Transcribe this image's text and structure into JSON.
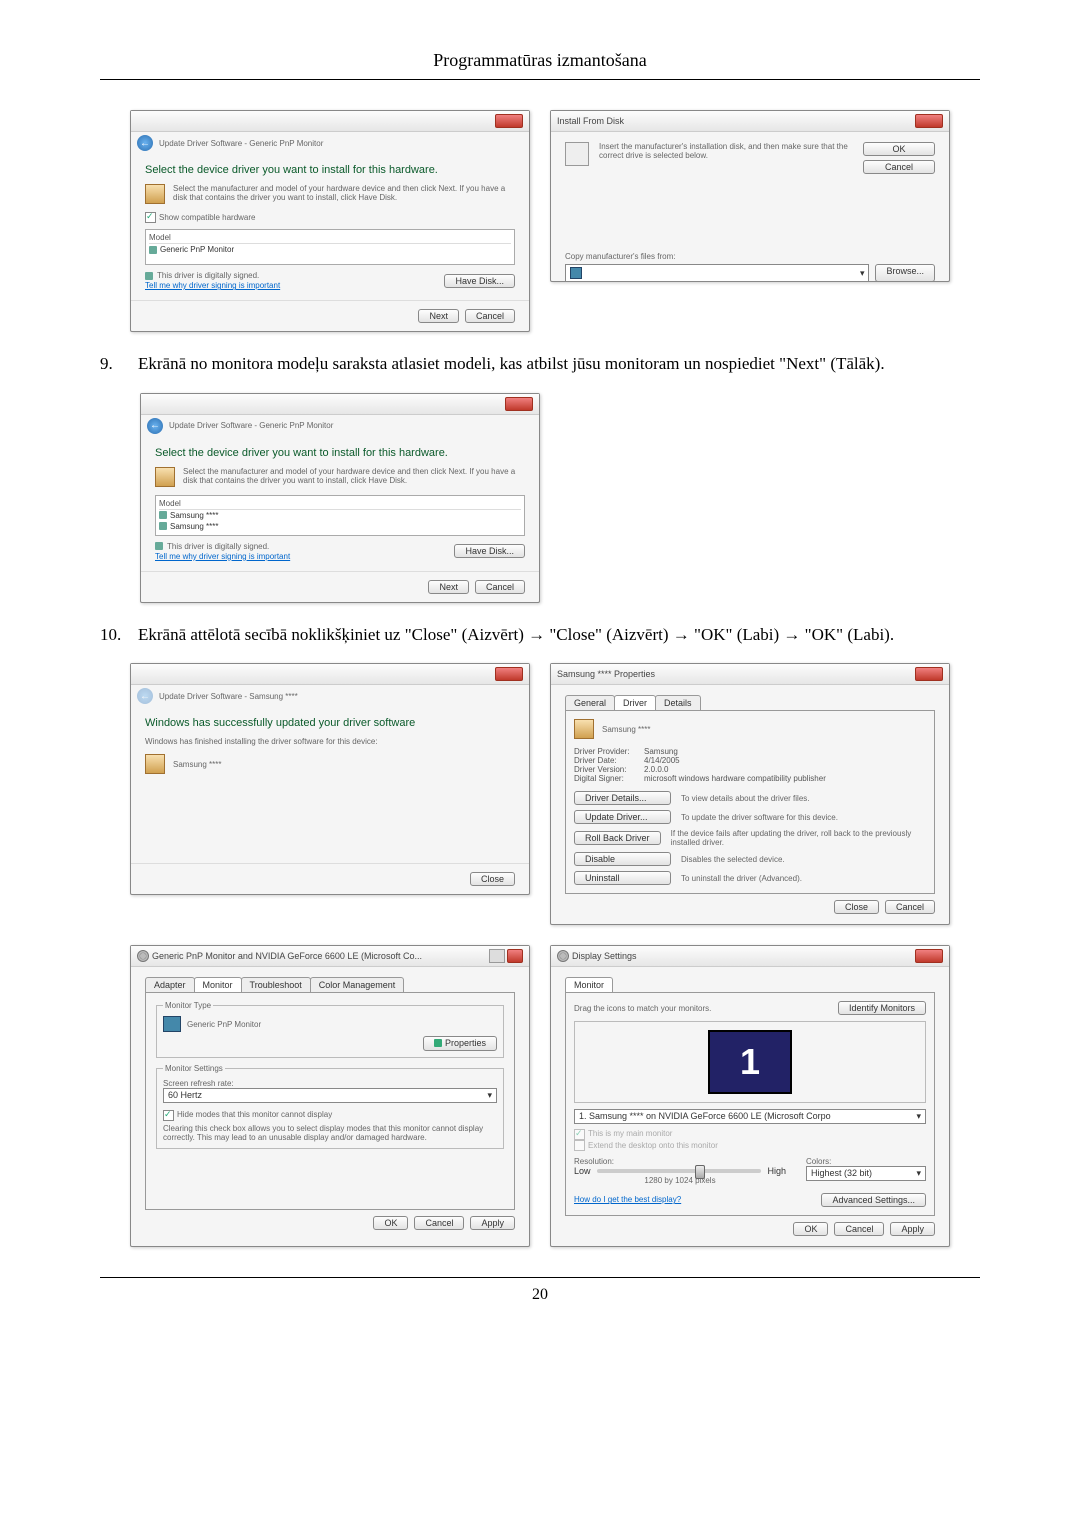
{
  "page_header": "Programmatūras izmantošana",
  "page_number": "20",
  "step9": {
    "num": "9.",
    "text": "Ekrānā no monitora modeļu saraksta atlasiet modeli, kas atbilst jūsu monitoram un nospiediet \"Next\" (Tālāk)."
  },
  "step10": {
    "num": "10.",
    "text": "Ekrānā attēlotā secībā noklikšķiniet uz \"Close\" (Aizvērt)  →  \"Close\" (Aizvērt)  →  \"OK\" (Labi)  →  \"OK\" (Labi)."
  },
  "wiz1": {
    "breadcrumb": "Update Driver Software - Generic PnP Monitor",
    "heading": "Select the device driver you want to install for this hardware.",
    "sub": "Select the manufacturer and model of your hardware device and then click Next. If you have a disk that contains the driver you want to install, click Have Disk.",
    "showcompat": "Show compatible hardware",
    "col_model": "Model",
    "row1": "Generic PnP Monitor",
    "signed": "This driver is digitally signed.",
    "tell": "Tell me why driver signing is important",
    "have_disk": "Have Disk...",
    "next": "Next",
    "cancel": "Cancel"
  },
  "installdisk": {
    "title": "Install From Disk",
    "msg": "Insert the manufacturer's installation disk, and then make sure that the correct drive is selected below.",
    "ok": "OK",
    "cancel": "Cancel",
    "copyfrom": "Copy manufacturer's files from:",
    "browse": "Browse..."
  },
  "wiz2": {
    "breadcrumb": "Update Driver Software - Generic PnP Monitor",
    "heading": "Select the device driver you want to install for this hardware.",
    "sub": "Select the manufacturer and model of your hardware device and then click Next. If you have a disk that contains the driver you want to install, click Have Disk.",
    "col_model": "Model",
    "row1": "Samsung ****",
    "row2": "Samsung ****",
    "signed": "This driver is digitally signed.",
    "tell": "Tell me why driver signing is important",
    "have_disk": "Have Disk...",
    "next": "Next",
    "cancel": "Cancel"
  },
  "wiz3": {
    "breadcrumb": "Update Driver Software - Samsung ****",
    "heading": "Windows has successfully updated your driver software",
    "sub": "Windows has finished installing the driver software for this device:",
    "device": "Samsung ****",
    "close": "Close"
  },
  "props": {
    "title": "Samsung **** Properties",
    "tab_general": "General",
    "tab_driver": "Driver",
    "tab_details": "Details",
    "device": "Samsung ****",
    "provider_lbl": "Driver Provider:",
    "provider_val": "Samsung",
    "date_lbl": "Driver Date:",
    "date_val": "4/14/2005",
    "version_lbl": "Driver Version:",
    "version_val": "2.0.0.0",
    "signer_lbl": "Digital Signer:",
    "signer_val": "microsoft windows hardware compatibility publisher",
    "btn_details": "Driver Details...",
    "txt_details": "To view details about the driver files.",
    "btn_update": "Update Driver...",
    "txt_update": "To update the driver software for this device.",
    "btn_rollback": "Roll Back Driver",
    "txt_rollback": "If the device fails after updating the driver, roll back to the previously installed driver.",
    "btn_disable": "Disable",
    "txt_disable": "Disables the selected device.",
    "btn_uninstall": "Uninstall",
    "txt_uninstall": "To uninstall the driver (Advanced).",
    "close": "Close",
    "cancel": "Cancel"
  },
  "adapter": {
    "title": "Generic PnP Monitor and NVIDIA GeForce 6600 LE (Microsoft Co...",
    "tab_adapter": "Adapter",
    "tab_monitor": "Monitor",
    "tab_troubleshoot": "Troubleshoot",
    "tab_color": "Color Management",
    "montype": "Monitor Type",
    "monname": "Generic PnP Monitor",
    "properties": "Properties",
    "monsettings": "Monitor Settings",
    "refresh_lbl": "Screen refresh rate:",
    "refresh_val": "60 Hertz",
    "hide": "Hide modes that this monitor cannot display",
    "hide_desc": "Clearing this check box allows you to select display modes that this monitor cannot display correctly. This may lead to an unusable display and/or damaged hardware.",
    "ok": "OK",
    "cancel": "Cancel",
    "apply": "Apply"
  },
  "display": {
    "title": "Display Settings",
    "tab_monitor": "Monitor",
    "drag": "Drag the icons to match your monitors.",
    "identify": "Identify Monitors",
    "monnum": "1",
    "device": "1. Samsung **** on NVIDIA GeForce 6600 LE (Microsoft Corpo",
    "ismain": "This is my main monitor",
    "extend": "Extend the desktop onto this monitor",
    "res_lbl": "Resolution:",
    "low": "Low",
    "high": "High",
    "res_val": "1280 by 1024 pixels",
    "colors_lbl": "Colors:",
    "colors_val": "Highest (32 bit)",
    "howbest": "How do I get the best display?",
    "advanced": "Advanced Settings...",
    "ok": "OK",
    "cancel": "Cancel",
    "apply": "Apply"
  }
}
